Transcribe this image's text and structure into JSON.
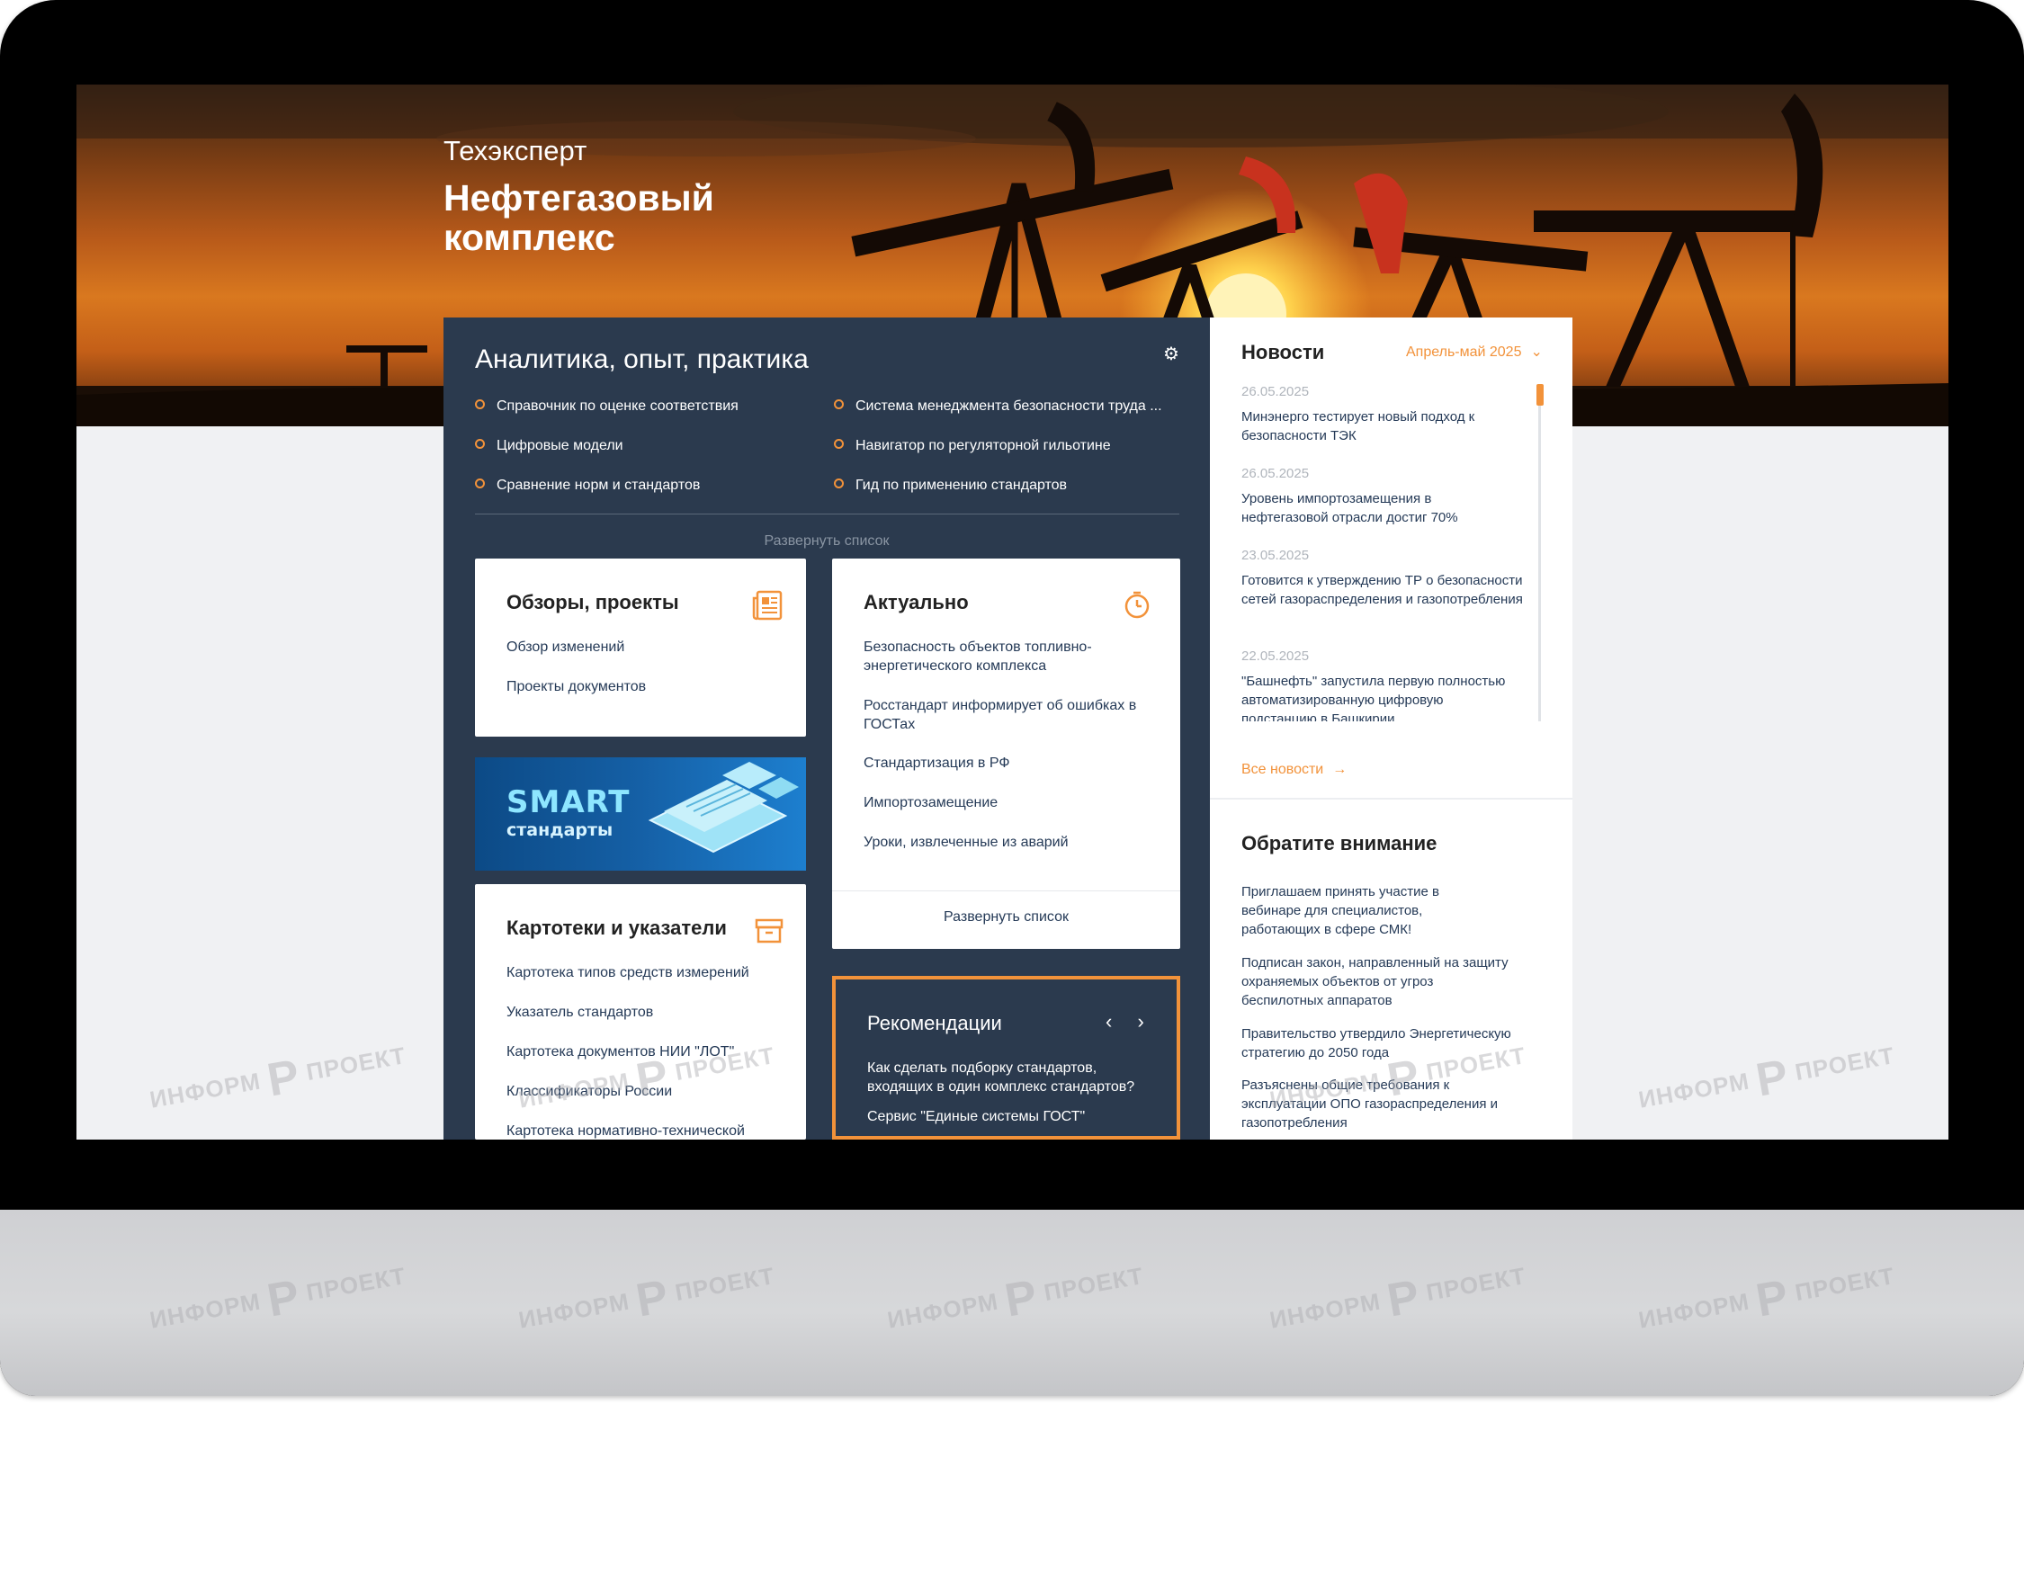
{
  "hero": {
    "brand_small": "Техэксперт",
    "brand_big": "Нефтегазовый комплекс"
  },
  "main": {
    "title": "Аналитика, опыт, практика",
    "gear_icon": "gear-icon",
    "links_left": [
      "Справочник по оценке соответствия",
      "Цифровые модели",
      "Сравнение норм и стандартов"
    ],
    "links_right": [
      "Система менеджмента безопасности труда ...",
      "Навигатор по регуляторной гильотине",
      "Гид по применению стандартов"
    ],
    "expand_label": "Развернуть список"
  },
  "reviews": {
    "title": "Обзоры, проекты",
    "icon": "newspaper-icon",
    "items": [
      "Обзор изменений",
      "Проекты документов"
    ]
  },
  "smart": {
    "line1": "SMART",
    "line2": "стандарты"
  },
  "catalogs": {
    "title": "Картотеки и указатели",
    "icon": "archive-icon",
    "items": [
      "Картотека типов средств измерений",
      "Указатель стандартов",
      "Картотека документов НИИ \"ЛОТ\"",
      "Классификаторы России",
      "Картотека нормативно-технической"
    ]
  },
  "actual": {
    "title": "Актуально",
    "icon": "stopwatch-icon",
    "items": [
      "Безопасность объектов топливно-энергетического комплекса",
      "Росстандарт информирует об ошибках в ГОСТах",
      "Стандартизация в РФ",
      "Импортозамещение",
      "Уроки, извлеченные из аварий"
    ],
    "expand_label": "Развернуть список"
  },
  "recommendations": {
    "title": "Рекомендации",
    "prev": "‹",
    "next": "›",
    "text1": "Как сделать подборку стандартов, входящих в один комплекс стандартов?",
    "text2": "Сервис \"Единые системы ГОСТ\""
  },
  "news": {
    "title": "Новости",
    "period": "Апрель-май 2025",
    "items": [
      {
        "date": "26.05.2025",
        "text": "Минэнерго тестирует новый подход к безопасности ТЭК"
      },
      {
        "date": "26.05.2025",
        "text": "Уровень импортозамещения в нефтегазовой отрасли достиг 70%"
      },
      {
        "date": "23.05.2025",
        "text": "Готовится к утверждению ТР о безопасности сетей газораспределения и газопотребления"
      },
      {
        "date": "22.05.2025",
        "text": "\"Башнефть\" запустила первую полностью автоматизированную цифровую подстанцию в Башкирии"
      }
    ],
    "all_label": "Все новости"
  },
  "attention": {
    "title": "Обратите внимание",
    "items": [
      "Приглашаем принять участие в вебинаре для специалистов, работающих в сфере СМК!",
      "Подписан закон, направленный на защиту охраняемых объектов от угроз беспилотных аппаратов",
      "Правительство утвердило Энергетическую стратегию до 2050 года",
      "Разъяснены общие требования к эксплуатации ОПО газораспределения и газопотребления"
    ]
  },
  "watermark": {
    "left": "ИНФОРМ",
    "right": "ПРОЕКТ"
  },
  "colors": {
    "accent": "#f2923a",
    "panel": "#2b3a4e",
    "link": "#253a57"
  }
}
